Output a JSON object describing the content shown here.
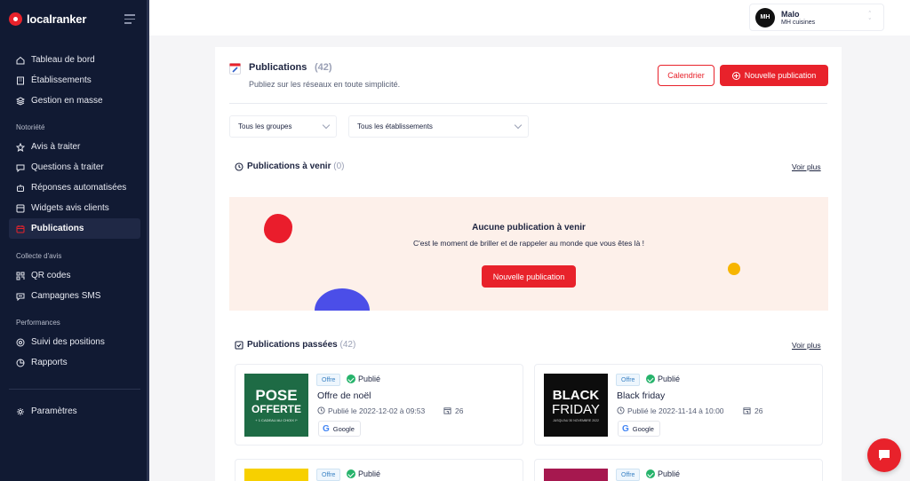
{
  "brand": {
    "name": "localranker",
    "accent": "#e8222b",
    "sidebar_bg": "#111a33"
  },
  "sidebar": {
    "items_top": [
      {
        "label": "Tableau de bord",
        "icon": "home-icon"
      },
      {
        "label": "Établissements",
        "icon": "building-icon"
      },
      {
        "label": "Gestion en masse",
        "icon": "stack-icon"
      }
    ],
    "section_notoriete": "Notoriété",
    "items_notoriete": [
      {
        "label": "Avis à traiter",
        "icon": "star-icon"
      },
      {
        "label": "Questions à traiter",
        "icon": "chat-icon"
      },
      {
        "label": "Réponses automatisées",
        "icon": "robot-icon"
      },
      {
        "label": "Widgets avis clients",
        "icon": "widget-icon"
      },
      {
        "label": "Publications",
        "icon": "calendar-icon",
        "active": true
      }
    ],
    "section_collecte": "Collecte d'avis",
    "items_collecte": [
      {
        "label": "QR codes",
        "icon": "qr-icon"
      },
      {
        "label": "Campagnes SMS",
        "icon": "sms-icon"
      }
    ],
    "section_performances": "Performances",
    "items_performances": [
      {
        "label": "Suivi des positions",
        "icon": "target-icon"
      },
      {
        "label": "Rapports",
        "icon": "pie-icon"
      }
    ],
    "settings": {
      "label": "Paramètres",
      "icon": "gear-icon"
    }
  },
  "user": {
    "initials": "MH",
    "sub_initials": "CUISINES",
    "name": "Malo",
    "company": "MH cuisines"
  },
  "header": {
    "title": "Publications",
    "count": "(42)",
    "subtitle": "Publiez sur les réseaux en toute simplicité.",
    "calendar_button": "Calendrier",
    "new_button": "Nouvelle publication"
  },
  "filters": {
    "groups": "Tous les groupes",
    "establishments": "Tous les établissements"
  },
  "upcoming": {
    "title": "Publications à venir",
    "count": "(0)",
    "see_more": "Voir plus",
    "empty_title": "Aucune publication à venir",
    "empty_text": "C'est le moment de briller et de rappeler au monde que vous êtes là !",
    "empty_button": "Nouvelle publication"
  },
  "past": {
    "title": "Publications passées",
    "count": "(42)",
    "see_more": "Voir plus",
    "cards": [
      {
        "type": "Offre",
        "status": "Publié",
        "name": "Offre de noël",
        "date": "Publié le 2022-12-02 à 09:53",
        "count": "26",
        "network": "Google",
        "thumb": {
          "line1": "POSE",
          "line2": "OFFERTE",
          "line3": "+ 1 CADEAU AU CHOIX !*",
          "bg": "#1e6b45"
        }
      },
      {
        "type": "Offre",
        "status": "Publié",
        "name": "Black friday",
        "date": "Publié le 2022-11-14 à 10:00",
        "count": "26",
        "network": "Google",
        "thumb": {
          "line1": "BLACK",
          "line2": "FRIDAY",
          "line3": "JUSQU'AU 30 NOVEMBRE 2022",
          "bg": "#0d0d0d"
        }
      },
      {
        "type": "Offre",
        "status": "Publié",
        "thumb_bg": "#f7d000"
      },
      {
        "type": "Offre",
        "status": "Publié",
        "thumb_bg": "#a6184f"
      }
    ]
  }
}
